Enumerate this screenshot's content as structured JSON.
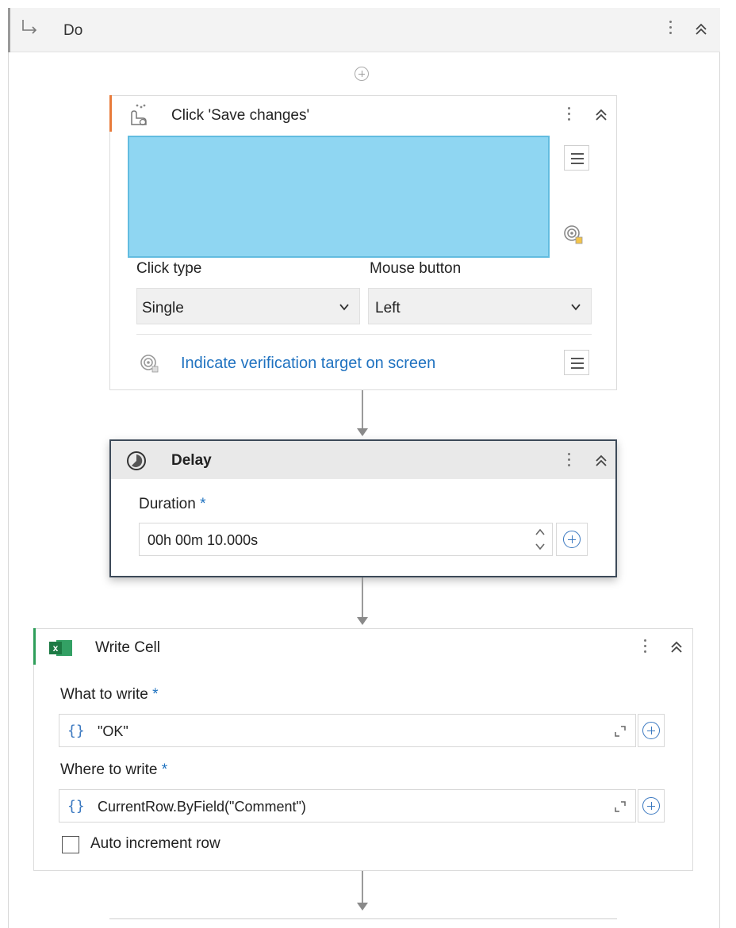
{
  "do_block": {
    "title": "Do"
  },
  "click_activity": {
    "title": "Click 'Save changes'",
    "click_type_label": "Click type",
    "click_type_value": "Single",
    "mouse_button_label": "Mouse button",
    "mouse_button_value": "Left",
    "verification_link": "Indicate verification target on screen"
  },
  "delay_activity": {
    "title": "Delay",
    "duration_label": "Duration",
    "required_mark": "*",
    "duration_value": "00h 00m 10.000s"
  },
  "write_cell_activity": {
    "title": "Write Cell",
    "what_label": "What to write",
    "what_value": "\"OK\"",
    "where_label": "Where to write",
    "where_value": "CurrentRow.ByField(\"Comment\")",
    "required_mark": "*",
    "braces": "{}",
    "auto_increment_label": "Auto increment row"
  },
  "colors": {
    "click_accent": "#e87b3a",
    "excel_accent": "#2e9e5a",
    "link_blue": "#1f72c0",
    "target_fill": "#8fd6f2",
    "delay_border": "#3d4a59"
  },
  "icons": [
    "arrow-return-icon",
    "kebab-menu-icon",
    "double-chevron-up-icon",
    "add-activity-icon",
    "click-activity-icon",
    "hamburger-menu-icon",
    "target-indicator-icon",
    "chevron-down-icon",
    "delay-clock-icon",
    "spinner-updown-icon",
    "plus-circle-icon",
    "excel-icon",
    "expand-icon",
    "checkbox"
  ]
}
